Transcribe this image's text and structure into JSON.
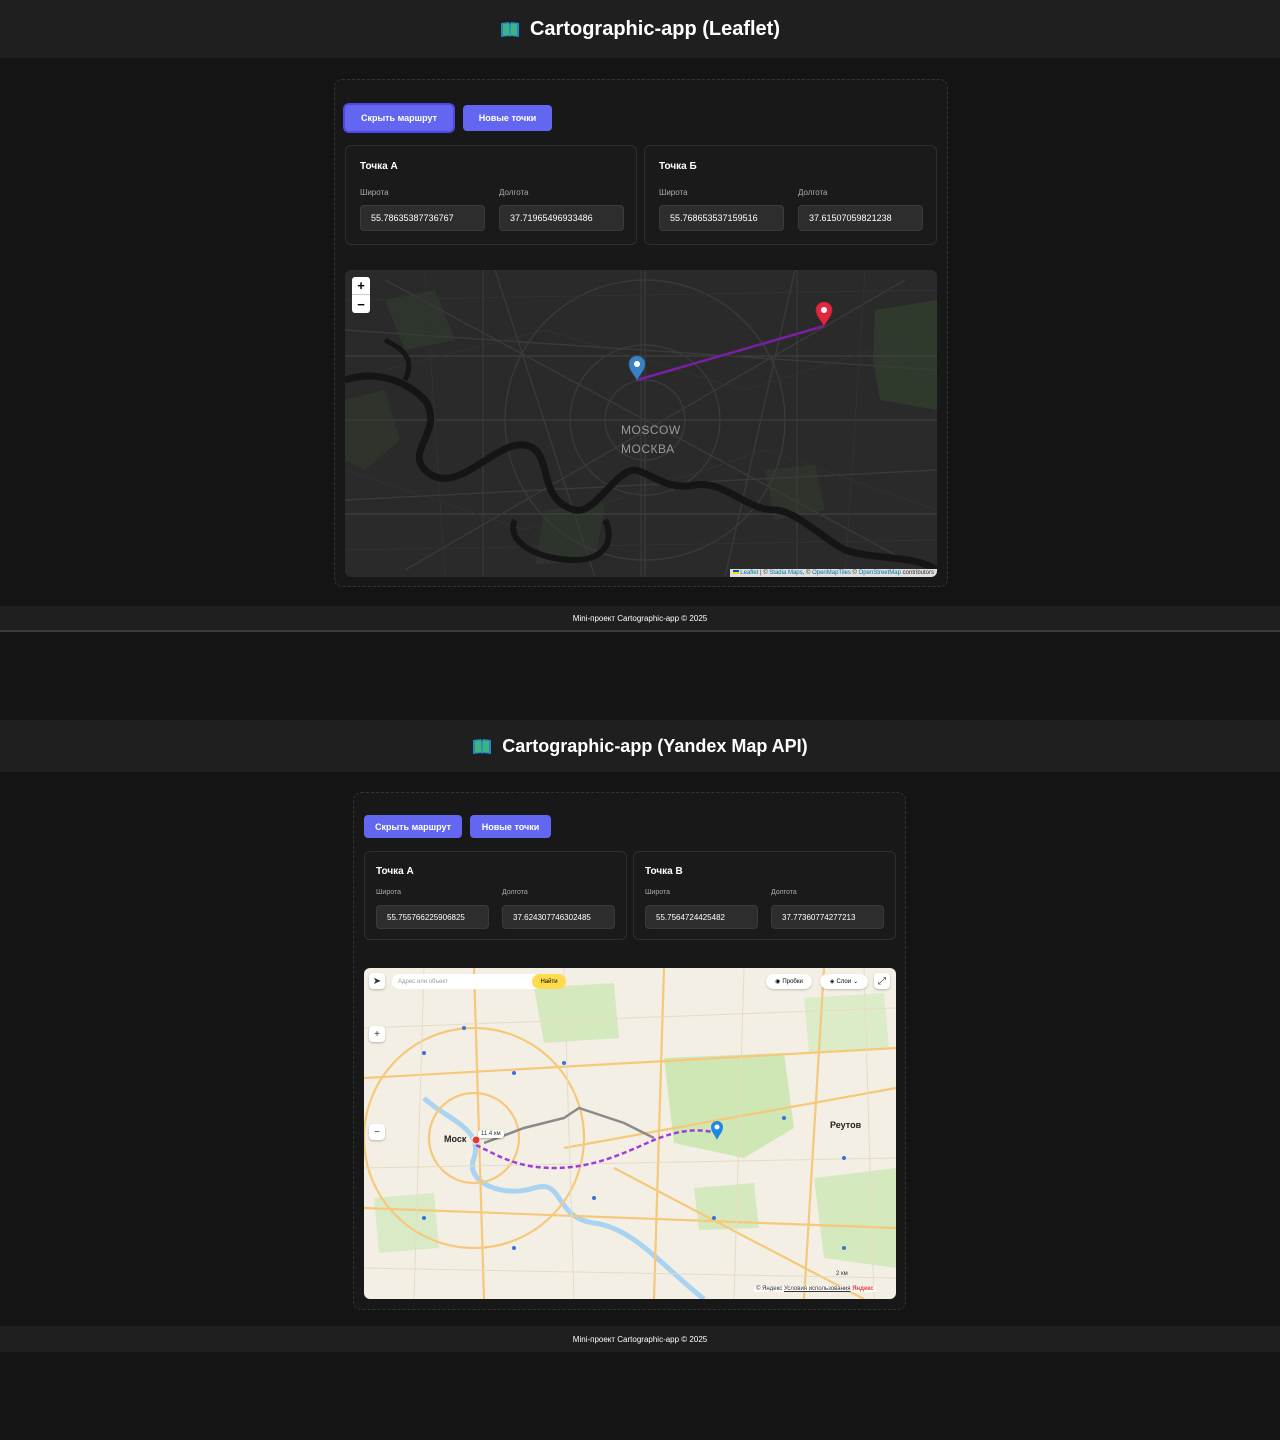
{
  "leaflet_app": {
    "title": "Cartographic-app (Leaflet)",
    "buttons": {
      "hide_route": "Скрыть маршрут",
      "new_points": "Новые точки"
    },
    "point_a": {
      "title": "Точка А",
      "lat_label": "Широта",
      "lng_label": "Долгота",
      "lat": "55.78635387736767",
      "lng": "37.71965496933486"
    },
    "point_b": {
      "title": "Точка Б",
      "lat_label": "Широта",
      "lng_label": "Долгота",
      "lat": "55.768653537159516",
      "lng": "37.61507059821238"
    },
    "map": {
      "zoom_in": "+",
      "zoom_out": "−",
      "city_en": "MOSCOW",
      "city_ru": "МОСКВА",
      "attribution": {
        "leaflet": "Leaflet",
        "sep1": " | © ",
        "stadia": "Stadia Maps",
        "sep2": ", © ",
        "omt": "OpenMapTiles",
        "sep3": " © ",
        "osm": "OpenStreetMap",
        "tail": " contributors"
      },
      "route_color": "#7a1fa2",
      "marker_a_color": "#3b82c4",
      "marker_b_color": "#e0283d"
    },
    "footer": "Mini-проект Cartographic-app © 2025"
  },
  "yandex_app": {
    "title": "Cartographic-app (Yandex Map API)",
    "buttons": {
      "hide_route": "Скрыть маршрут",
      "new_points": "Новые точки"
    },
    "point_a": {
      "title": "Точка А",
      "lat_label": "Широта",
      "lng_label": "Долгота",
      "lat": "55.755766225906825",
      "lng": "37.624307746302485"
    },
    "point_b": {
      "title": "Точка В",
      "lat_label": "Широта",
      "lng_label": "Долгота",
      "lat": "55.7564724425482",
      "lng": "37.77360774277213"
    },
    "map": {
      "search_placeholder": "Адрес или объект",
      "find": "Найти",
      "traffic": "Пробки",
      "layers": "Слои",
      "city_moscow": "Моск",
      "city_reutov": "Реутов",
      "distance": "11.4 км",
      "scale": "2 км",
      "copyright": "© Яндекс",
      "terms": "Условия использования",
      "logo": "Яндекс",
      "route_color": "#a03cdc",
      "marker_color": "#1e88e5"
    },
    "footer": "Mini-проект Cartographic-app © 2025"
  },
  "colors": {
    "accent": "#6366f1",
    "bg": "#141414",
    "header": "#1f1f1f"
  }
}
